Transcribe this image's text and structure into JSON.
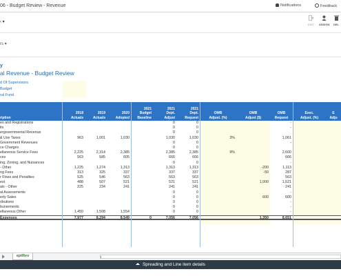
{
  "topbar": {
    "title": "06 - Budget Review - Revenue",
    "notifications": "Notifications",
    "feedback": "Feedback"
  },
  "toolbar": {
    "selector_glyph": "‹",
    "tools": [
      {
        "label": "EXIT",
        "disabled": true
      },
      {
        "label": "ASSIGN",
        "disabled": false
      },
      {
        "label": "DEL",
        "disabled": false
      }
    ]
  },
  "view_dropdown": "rs",
  "header": {
    "entity": "y",
    "report_title": "al Revenue - Budget Review",
    "line1": "d Of Supervisors",
    "line2": "Budget",
    "line3": "ral Fund"
  },
  "grid": {
    "columns": [
      {
        "l1": "",
        "l2": "",
        "l3": "ription"
      },
      {
        "l1": "",
        "l2": "2018",
        "l3": "Actuals"
      },
      {
        "l1": "",
        "l2": "2019",
        "l3": "Actuals"
      },
      {
        "l1": "",
        "l2": "2020",
        "l3": "Adopted"
      },
      {
        "l1": "2021",
        "l2": "Budget",
        "l3": "Baseline"
      },
      {
        "l1": "2021",
        "l2": "Dept.",
        "l3": "Adjust"
      },
      {
        "l1": "2021",
        "l2": "Dept.",
        "l3": "Request"
      },
      {
        "l1": "",
        "l2": "OMB",
        "l3": "Adjust. (%)"
      },
      {
        "l1": "",
        "l2": "OMB",
        "l3": "Adjust ($)"
      },
      {
        "l1": "",
        "l2": "OMB",
        "l3": "Request"
      },
      {
        "l1": "",
        "l2": "Exec.",
        "l3": "Adjust. (%)"
      },
      {
        "l1": "",
        "l2": "E",
        "l3": "Adju"
      }
    ],
    "rows": [
      [
        "es and Registrations",
        "",
        "",
        "",
        "",
        "0",
        "0",
        "",
        "",
        "-",
        "",
        ""
      ],
      [
        "its",
        "",
        "",
        "",
        "",
        "0",
        "0",
        "",
        "",
        "-",
        "",
        ""
      ],
      [
        "ergovernmental Revenue",
        "",
        "",
        "",
        "",
        "0",
        "0",
        "",
        "",
        "",
        "",
        ""
      ],
      [
        "& Use Taxes",
        "963",
        "1,001",
        "1,030",
        "",
        "1,030",
        "1,030",
        "3%",
        "",
        "1,061",
        "",
        ""
      ],
      [
        "Government Revenues",
        "",
        "",
        "",
        "",
        "0",
        "0",
        "",
        "",
        "-",
        "",
        ""
      ],
      [
        "ce Charges",
        "",
        "",
        "",
        "",
        "0",
        "0",
        "",
        "",
        "",
        "",
        ""
      ],
      [
        "ellaneous Service Fees",
        "2,225",
        "2,314",
        "2,385",
        "",
        "2,385",
        "2,385",
        "9%",
        "",
        "2,600",
        "",
        ""
      ],
      [
        "ces",
        "563",
        "585",
        "605",
        "",
        "666",
        "666",
        "",
        "",
        "666",
        "",
        ""
      ],
      [
        "ing, Zoning, and Nuisances",
        "",
        "",
        "",
        "",
        "0",
        "0",
        "",
        "",
        "-",
        "",
        ""
      ],
      [
        "- Other",
        "1,225",
        "1,274",
        "1,313",
        "",
        "1,313",
        "1,313",
        "",
        "-200",
        "1,113",
        "",
        ""
      ],
      [
        "ng Fees",
        "313",
        "325",
        "337",
        "",
        "337",
        "337",
        "",
        "-50",
        "287",
        "",
        ""
      ],
      [
        "r Fines and Penalties",
        "525",
        "546",
        "563",
        "",
        "563",
        "563",
        "",
        "",
        "563",
        "",
        ""
      ],
      [
        "est",
        "488",
        "507",
        "521",
        "",
        "521",
        "521",
        "",
        "1,000",
        "1,521",
        "",
        ""
      ],
      [
        "als - Other",
        "225",
        "234",
        "241",
        "",
        "241",
        "241",
        "",
        "",
        "241",
        "",
        ""
      ],
      [
        "al Assessments",
        "",
        "",
        "",
        "",
        "0",
        "0",
        "",
        "",
        "-",
        "",
        ""
      ],
      [
        "erty Sales",
        "",
        "",
        "",
        "",
        "0",
        "0",
        "",
        "600",
        "600",
        "",
        ""
      ],
      [
        "ributions",
        "",
        "",
        "",
        "",
        "0",
        "0",
        "",
        "",
        "-",
        "",
        ""
      ],
      [
        "bursements",
        "",
        "",
        "",
        "",
        "0",
        "0",
        "",
        "",
        "-",
        "",
        ""
      ],
      [
        "ellaneous Other",
        "1,450",
        "1,508",
        "1,554",
        "",
        "0",
        "0",
        "",
        "",
        "-",
        "",
        ""
      ]
    ],
    "total": [
      "Expenses",
      "7,977",
      "8,294",
      "8,549",
      "0",
      "7,056",
      "7,056",
      "",
      "1,350",
      "8,651",
      "",
      ""
    ]
  },
  "footer": {
    "sheet_tab": "eptRev",
    "panel_label": "Spreading and Line item details"
  }
}
